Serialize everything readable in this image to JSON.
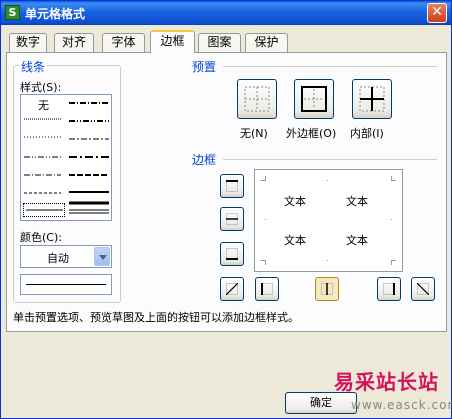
{
  "window": {
    "title": "单元格格式",
    "app_icon": "S",
    "close_icon": "close-icon"
  },
  "tabs": [
    {
      "label": "数字",
      "active": false
    },
    {
      "label": "对齐",
      "active": false
    },
    {
      "label": "字体",
      "active": false
    },
    {
      "label": "边框",
      "active": true
    },
    {
      "label": "图案",
      "active": false
    },
    {
      "label": "保护",
      "active": false
    }
  ],
  "line_group": {
    "title": "线条",
    "style_label": "样式(S):",
    "style_none": "无",
    "color_label": "颜色(C):",
    "color_value": "自动"
  },
  "preset_group": {
    "title": "预置",
    "buttons": [
      {
        "label": "无(N)"
      },
      {
        "label": "外边框(O)"
      },
      {
        "label": "内部(I)"
      }
    ]
  },
  "border_group": {
    "title": "边框",
    "preview_text": [
      "文本",
      "文本",
      "文本",
      "文本"
    ]
  },
  "description": "单击预置选项、预览草图及上面的按钮可以添加边框样式。",
  "buttons": {
    "ok": "确定"
  },
  "watermark": {
    "title": "易采站长站",
    "url": "www.easck.com"
  },
  "colors": {
    "title_bar": "#1a63e0",
    "group_title": "#0046d5",
    "dialog_bg": "#ece9d8",
    "watermark": "#d8125a"
  }
}
